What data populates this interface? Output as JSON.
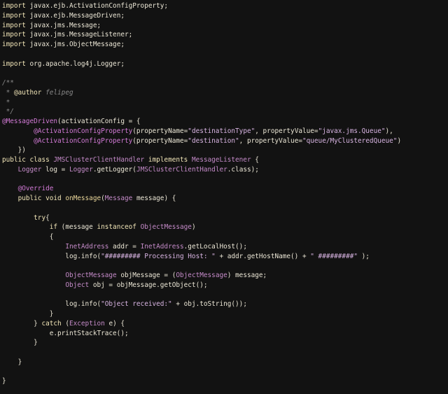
{
  "editor": {
    "language": "java",
    "theme": "dark",
    "background": "#121212",
    "lines": [
      [
        {
          "t": "import ",
          "c": "keyword"
        },
        {
          "t": "javax.ejb.ActivationConfigProperty;",
          "c": "plain"
        }
      ],
      [
        {
          "t": "import ",
          "c": "keyword"
        },
        {
          "t": "javax.ejb.MessageDriven;",
          "c": "plain"
        }
      ],
      [
        {
          "t": "import ",
          "c": "keyword"
        },
        {
          "t": "javax.jms.Message;",
          "c": "plain"
        }
      ],
      [
        {
          "t": "import ",
          "c": "keyword"
        },
        {
          "t": "javax.jms.MessageListener;",
          "c": "plain"
        }
      ],
      [
        {
          "t": "import ",
          "c": "keyword"
        },
        {
          "t": "javax.jms.ObjectMessage;",
          "c": "plain"
        }
      ],
      [],
      [
        {
          "t": "import ",
          "c": "keyword"
        },
        {
          "t": "org.apache.log4j.Logger;",
          "c": "plain"
        }
      ],
      [],
      [
        {
          "t": "/**",
          "c": "comment"
        }
      ],
      [
        {
          "t": " * ",
          "c": "comment"
        },
        {
          "t": "@author",
          "c": "keyword"
        },
        {
          "t": " felipeg",
          "c": "comment"
        }
      ],
      [
        {
          "t": " *",
          "c": "comment"
        }
      ],
      [
        {
          "t": " */",
          "c": "comment"
        }
      ],
      [
        {
          "t": "@MessageDriven",
          "c": "annotation"
        },
        {
          "t": "(activationConfig = {",
          "c": "plain"
        }
      ],
      [
        {
          "t": "        ",
          "c": "plain"
        },
        {
          "t": "@ActivationConfigProperty",
          "c": "annotation"
        },
        {
          "t": "(propertyName=",
          "c": "plain"
        },
        {
          "t": "\"destinationType\"",
          "c": "string"
        },
        {
          "t": ", propertyValue=",
          "c": "plain"
        },
        {
          "t": "\"javax.jms.Queue\"",
          "c": "string"
        },
        {
          "t": "),",
          "c": "plain"
        }
      ],
      [
        {
          "t": "        ",
          "c": "plain"
        },
        {
          "t": "@ActivationConfigProperty",
          "c": "annotation"
        },
        {
          "t": "(propertyName=",
          "c": "plain"
        },
        {
          "t": "\"destination\"",
          "c": "string"
        },
        {
          "t": ", propertyValue=",
          "c": "plain"
        },
        {
          "t": "\"queue/MyClusteredQueue\"",
          "c": "string"
        },
        {
          "t": ")",
          "c": "plain"
        }
      ],
      [
        {
          "t": "    })",
          "c": "plain"
        }
      ],
      [
        {
          "t": "public class ",
          "c": "keyword"
        },
        {
          "t": "JMSClusterClientHandler ",
          "c": "type"
        },
        {
          "t": "implements ",
          "c": "keyword"
        },
        {
          "t": "MessageListener ",
          "c": "type"
        },
        {
          "t": "{",
          "c": "plain"
        }
      ],
      [
        {
          "t": "    ",
          "c": "plain"
        },
        {
          "t": "Logger ",
          "c": "type"
        },
        {
          "t": "log = ",
          "c": "plain"
        },
        {
          "t": "Logger",
          "c": "type"
        },
        {
          "t": ".getLogger(",
          "c": "plain"
        },
        {
          "t": "JMSClusterClientHandler",
          "c": "type"
        },
        {
          "t": ".class);",
          "c": "plain"
        }
      ],
      [],
      [
        {
          "t": "    ",
          "c": "plain"
        },
        {
          "t": "@Override",
          "c": "annotation"
        }
      ],
      [
        {
          "t": "    ",
          "c": "plain"
        },
        {
          "t": "public void ",
          "c": "keyword"
        },
        {
          "t": "onMessage",
          "c": "method"
        },
        {
          "t": "(",
          "c": "plain"
        },
        {
          "t": "Message ",
          "c": "type"
        },
        {
          "t": "message) {",
          "c": "plain"
        }
      ],
      [],
      [
        {
          "t": "        ",
          "c": "plain"
        },
        {
          "t": "try",
          "c": "keyword"
        },
        {
          "t": "{",
          "c": "plain"
        }
      ],
      [
        {
          "t": "            ",
          "c": "plain"
        },
        {
          "t": "if ",
          "c": "keyword"
        },
        {
          "t": "(message ",
          "c": "plain"
        },
        {
          "t": "instanceof ",
          "c": "keyword"
        },
        {
          "t": "ObjectMessage",
          "c": "type"
        },
        {
          "t": ")",
          "c": "plain"
        }
      ],
      [
        {
          "t": "            {",
          "c": "plain"
        }
      ],
      [
        {
          "t": "                ",
          "c": "plain"
        },
        {
          "t": "InetAddress ",
          "c": "type"
        },
        {
          "t": "addr = ",
          "c": "plain"
        },
        {
          "t": "InetAddress",
          "c": "type"
        },
        {
          "t": ".getLocalHost();",
          "c": "plain"
        }
      ],
      [
        {
          "t": "                log.info(",
          "c": "plain"
        },
        {
          "t": "\"######### Processing Host: \"",
          "c": "string"
        },
        {
          "t": " + addr.getHostName() + ",
          "c": "plain"
        },
        {
          "t": "\" #########\"",
          "c": "string"
        },
        {
          "t": " );",
          "c": "plain"
        }
      ],
      [],
      [
        {
          "t": "                ",
          "c": "plain"
        },
        {
          "t": "ObjectMessage ",
          "c": "type"
        },
        {
          "t": "objMessage = (",
          "c": "plain"
        },
        {
          "t": "ObjectMessage",
          "c": "type"
        },
        {
          "t": ") message;",
          "c": "plain"
        }
      ],
      [
        {
          "t": "                ",
          "c": "plain"
        },
        {
          "t": "Object ",
          "c": "type"
        },
        {
          "t": "obj = objMessage.getObject();",
          "c": "plain"
        }
      ],
      [],
      [
        {
          "t": "                log.info(",
          "c": "plain"
        },
        {
          "t": "\"Object received:\"",
          "c": "string"
        },
        {
          "t": " + obj.toString());",
          "c": "plain"
        }
      ],
      [
        {
          "t": "            }",
          "c": "plain"
        }
      ],
      [
        {
          "t": "        } ",
          "c": "plain"
        },
        {
          "t": "catch ",
          "c": "keyword"
        },
        {
          "t": "(",
          "c": "plain"
        },
        {
          "t": "Exception ",
          "c": "type"
        },
        {
          "t": "e) {",
          "c": "plain"
        }
      ],
      [
        {
          "t": "            e.printStackTrace();",
          "c": "plain"
        }
      ],
      [
        {
          "t": "        }",
          "c": "plain"
        }
      ],
      [],
      [
        {
          "t": "    }",
          "c": "plain"
        }
      ],
      [],
      [
        {
          "t": "}",
          "c": "plain"
        }
      ]
    ]
  }
}
